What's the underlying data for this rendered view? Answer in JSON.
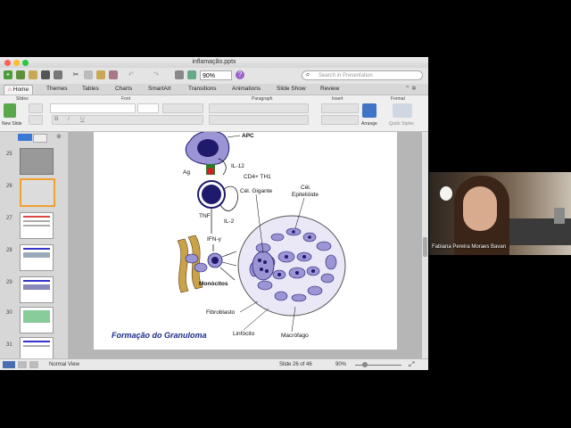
{
  "window": {
    "title": "inflamação.pptx",
    "zoom": "90%",
    "search_placeholder": "Search in Presentation"
  },
  "tabs": [
    "Home",
    "Themes",
    "Tables",
    "Charts",
    "SmartArt",
    "Transitions",
    "Animations",
    "Slide Show",
    "Review"
  ],
  "ribbon": {
    "groups": [
      "Slides",
      "Font",
      "Paragraph",
      "Insert",
      "Format"
    ],
    "new_slide": "New Slide",
    "arrange": "Arrange",
    "quick_styles": "Quick Styles"
  },
  "thumbnails": [
    "25",
    "26",
    "27",
    "28",
    "29",
    "30",
    "31"
  ],
  "slide": {
    "title": "Formação do Granuloma",
    "labels": {
      "apc": "APC",
      "il12": "IL-12",
      "ag": "Ag",
      "cd4": "CD4+ TH1",
      "il2": "IL-2",
      "tnf": "TNF",
      "ifn": "IFN-γ",
      "monocitos": "Monócitos",
      "cel_gigante": "Cél. Gigante",
      "cel_epit1": "Cél.",
      "cel_epit2": "Epitelióide",
      "fibroblasto": "Fibroblasto",
      "linfocito": "Linfócito",
      "macrofago": "Macrófago"
    }
  },
  "status": {
    "view": "Normal View",
    "slide_of": "Slide 26 of 46",
    "zoom": "90%"
  },
  "video": {
    "participant": "Fabiana Pereira Moraes Bavan"
  },
  "colors": {
    "cell_fill": "#9b95d6",
    "cell_nucleus": "#1f1a6b",
    "title_color": "#1a2a8a"
  }
}
